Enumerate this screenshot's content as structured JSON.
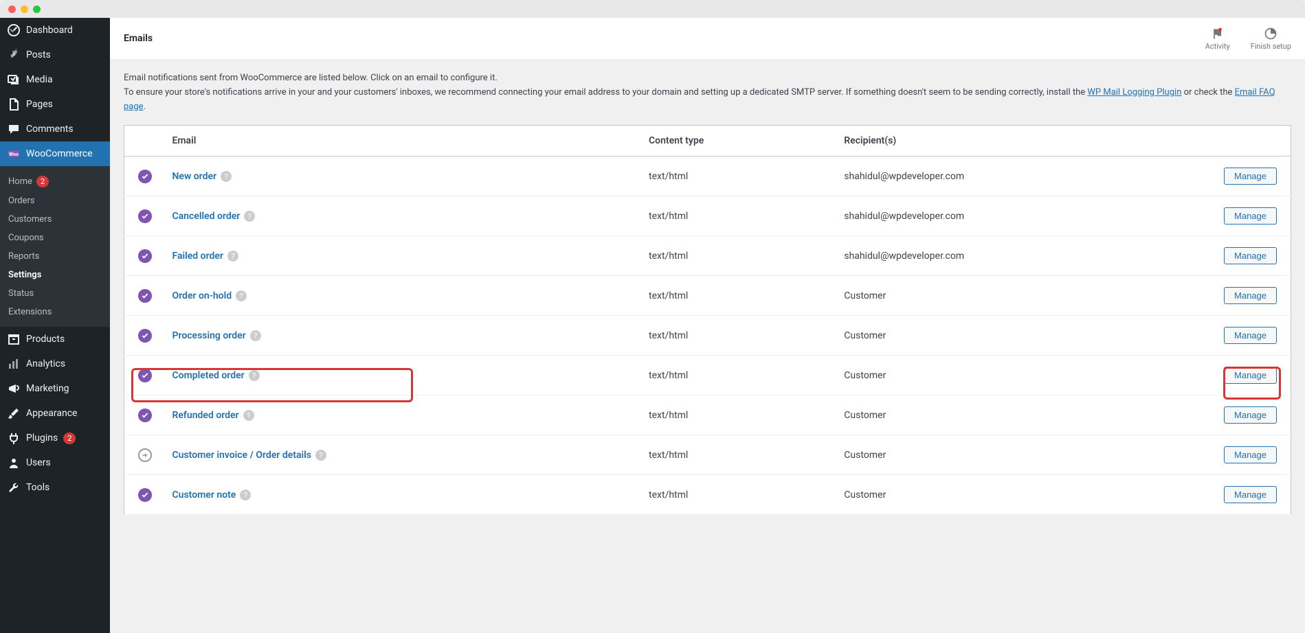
{
  "page": {
    "title": "Emails"
  },
  "topbar": {
    "activity": "Activity",
    "finish_setup": "Finish setup"
  },
  "sidebar": {
    "items": [
      {
        "label": "Dashboard",
        "icon": "dashboard"
      },
      {
        "label": "Posts",
        "icon": "pin"
      },
      {
        "label": "Media",
        "icon": "media"
      },
      {
        "label": "Pages",
        "icon": "page"
      },
      {
        "label": "Comments",
        "icon": "comment"
      },
      {
        "label": "WooCommerce",
        "icon": "woo",
        "active": true
      },
      {
        "label": "Products",
        "icon": "archive"
      },
      {
        "label": "Analytics",
        "icon": "chart"
      },
      {
        "label": "Marketing",
        "icon": "megaphone"
      },
      {
        "label": "Appearance",
        "icon": "brush"
      },
      {
        "label": "Plugins",
        "icon": "plug",
        "badge": "2"
      },
      {
        "label": "Users",
        "icon": "user"
      },
      {
        "label": "Tools",
        "icon": "wrench"
      }
    ],
    "submenu": [
      {
        "label": "Home",
        "badge": "2"
      },
      {
        "label": "Orders"
      },
      {
        "label": "Customers"
      },
      {
        "label": "Coupons"
      },
      {
        "label": "Reports"
      },
      {
        "label": "Settings",
        "current": true
      },
      {
        "label": "Status"
      },
      {
        "label": "Extensions"
      }
    ]
  },
  "intro": {
    "line1": "Email notifications sent from WooCommerce are listed below. Click on an email to configure it.",
    "line2a": "To ensure your store's notifications arrive in your and your customers' inboxes, we recommend connecting your email address to your domain and setting up a dedicated SMTP server. If something doesn't seem to be sending correctly, install the ",
    "link1": "WP Mail Logging Plugin",
    "line2b": " or check the ",
    "link2": "Email FAQ page",
    "line2c": "."
  },
  "table": {
    "headers": {
      "email": "Email",
      "content_type": "Content type",
      "recipients": "Recipient(s)"
    },
    "manage_label": "Manage",
    "rows": [
      {
        "name": "New order",
        "type": "text/html",
        "recipients": "shahidul@wpdeveloper.com",
        "enabled": true
      },
      {
        "name": "Cancelled order",
        "type": "text/html",
        "recipients": "shahidul@wpdeveloper.com",
        "enabled": true
      },
      {
        "name": "Failed order",
        "type": "text/html",
        "recipients": "shahidul@wpdeveloper.com",
        "enabled": true
      },
      {
        "name": "Order on-hold",
        "type": "text/html",
        "recipients": "Customer",
        "enabled": true
      },
      {
        "name": "Processing order",
        "type": "text/html",
        "recipients": "Customer",
        "enabled": true
      },
      {
        "name": "Completed order",
        "type": "text/html",
        "recipients": "Customer",
        "enabled": true,
        "highlighted": true
      },
      {
        "name": "Refunded order",
        "type": "text/html",
        "recipients": "Customer",
        "enabled": true
      },
      {
        "name": "Customer invoice / Order details",
        "type": "text/html",
        "recipients": "Customer",
        "enabled": false
      },
      {
        "name": "Customer note",
        "type": "text/html",
        "recipients": "Customer",
        "enabled": true
      }
    ]
  }
}
